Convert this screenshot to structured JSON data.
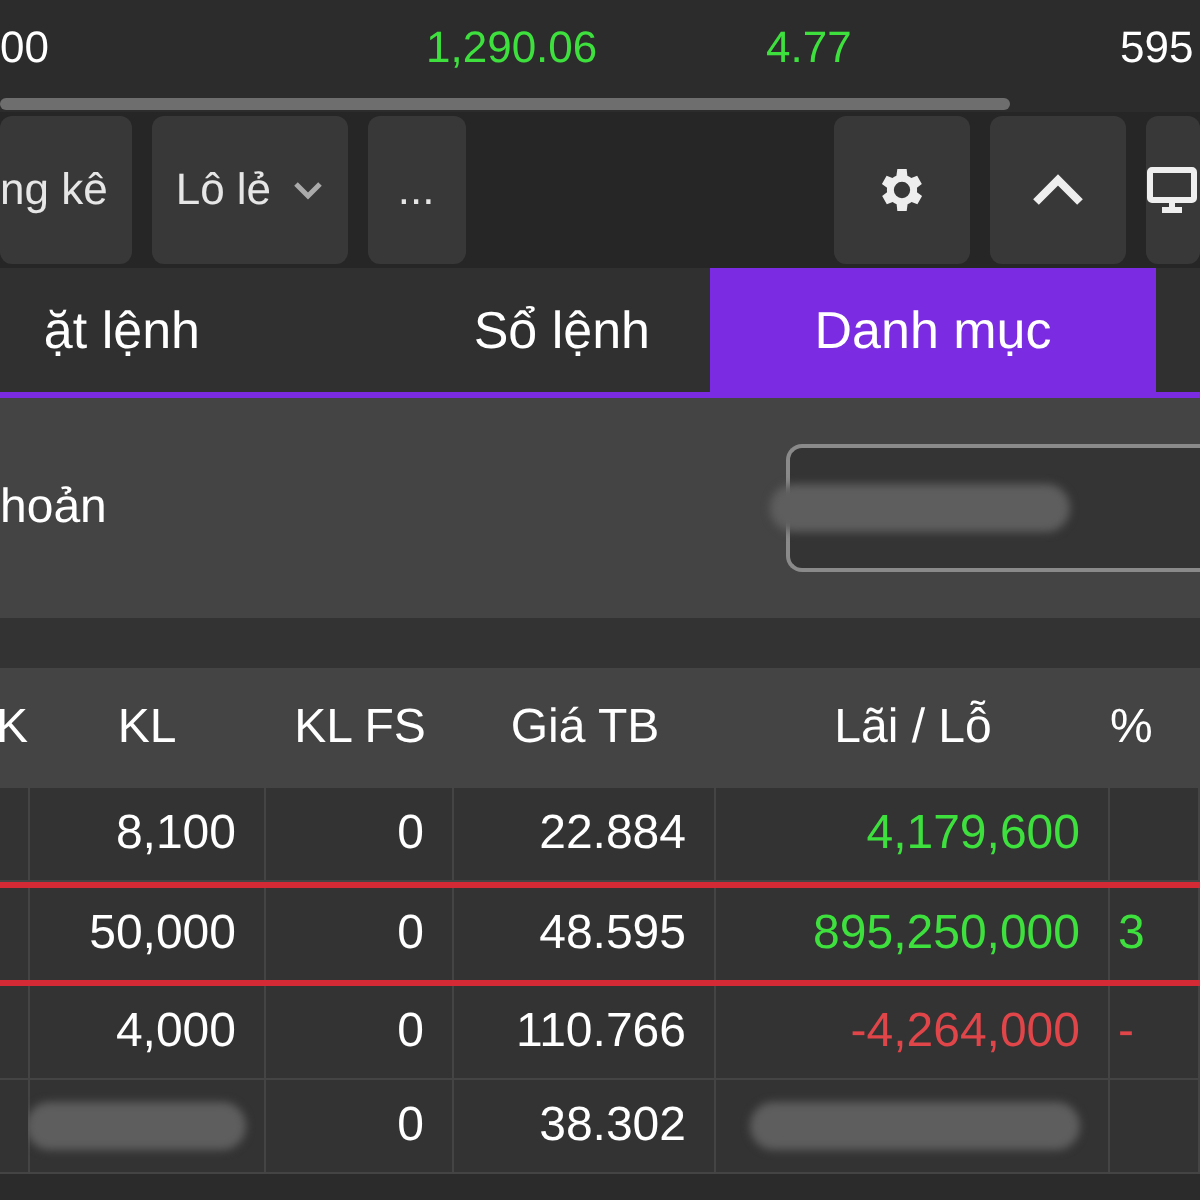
{
  "ticker": [
    {
      "value": "00",
      "kind": "plain"
    },
    {
      "value": "1,290.06",
      "kind": "up"
    },
    {
      "value": "4.77",
      "kind": "up"
    },
    {
      "value": "595",
      "kind": "plain"
    }
  ],
  "toolbar": {
    "left": [
      {
        "label": "ng kê",
        "kind": "plain"
      },
      {
        "label": "Lô lẻ",
        "kind": "dropdown"
      },
      {
        "label": "...",
        "kind": "plain"
      }
    ],
    "right": [
      {
        "kind": "gear"
      },
      {
        "kind": "caret-up"
      },
      {
        "kind": "monitor"
      }
    ]
  },
  "tabs": [
    {
      "label": "ặt lệnh",
      "selected": false
    },
    {
      "label": "Sổ lệnh",
      "selected": false
    },
    {
      "label": "Danh mục",
      "selected": true
    }
  ],
  "account": {
    "label": "hoản"
  },
  "table": {
    "columns": [
      "K",
      "KL",
      "KL FS",
      "Giá TB",
      "Lãi / Lỗ",
      "%"
    ],
    "rows": [
      {
        "kl": "8,100",
        "kl_fs": "0",
        "avg": "22.884",
        "pnl": "4,179,600",
        "kind": "gain",
        "highlighted": false
      },
      {
        "kl": "50,000",
        "kl_fs": "0",
        "avg": "48.595",
        "pnl": "895,250,000",
        "pct": "3",
        "kind": "gain",
        "highlighted": true
      },
      {
        "kl": "4,000",
        "kl_fs": "0",
        "avg": "110.766",
        "pnl": "-4,264,000",
        "pct": "-",
        "kind": "loss",
        "highlighted": false
      },
      {
        "kl_fs": "0",
        "avg": "38.302",
        "kind": "redacted",
        "highlighted": false
      }
    ]
  }
}
